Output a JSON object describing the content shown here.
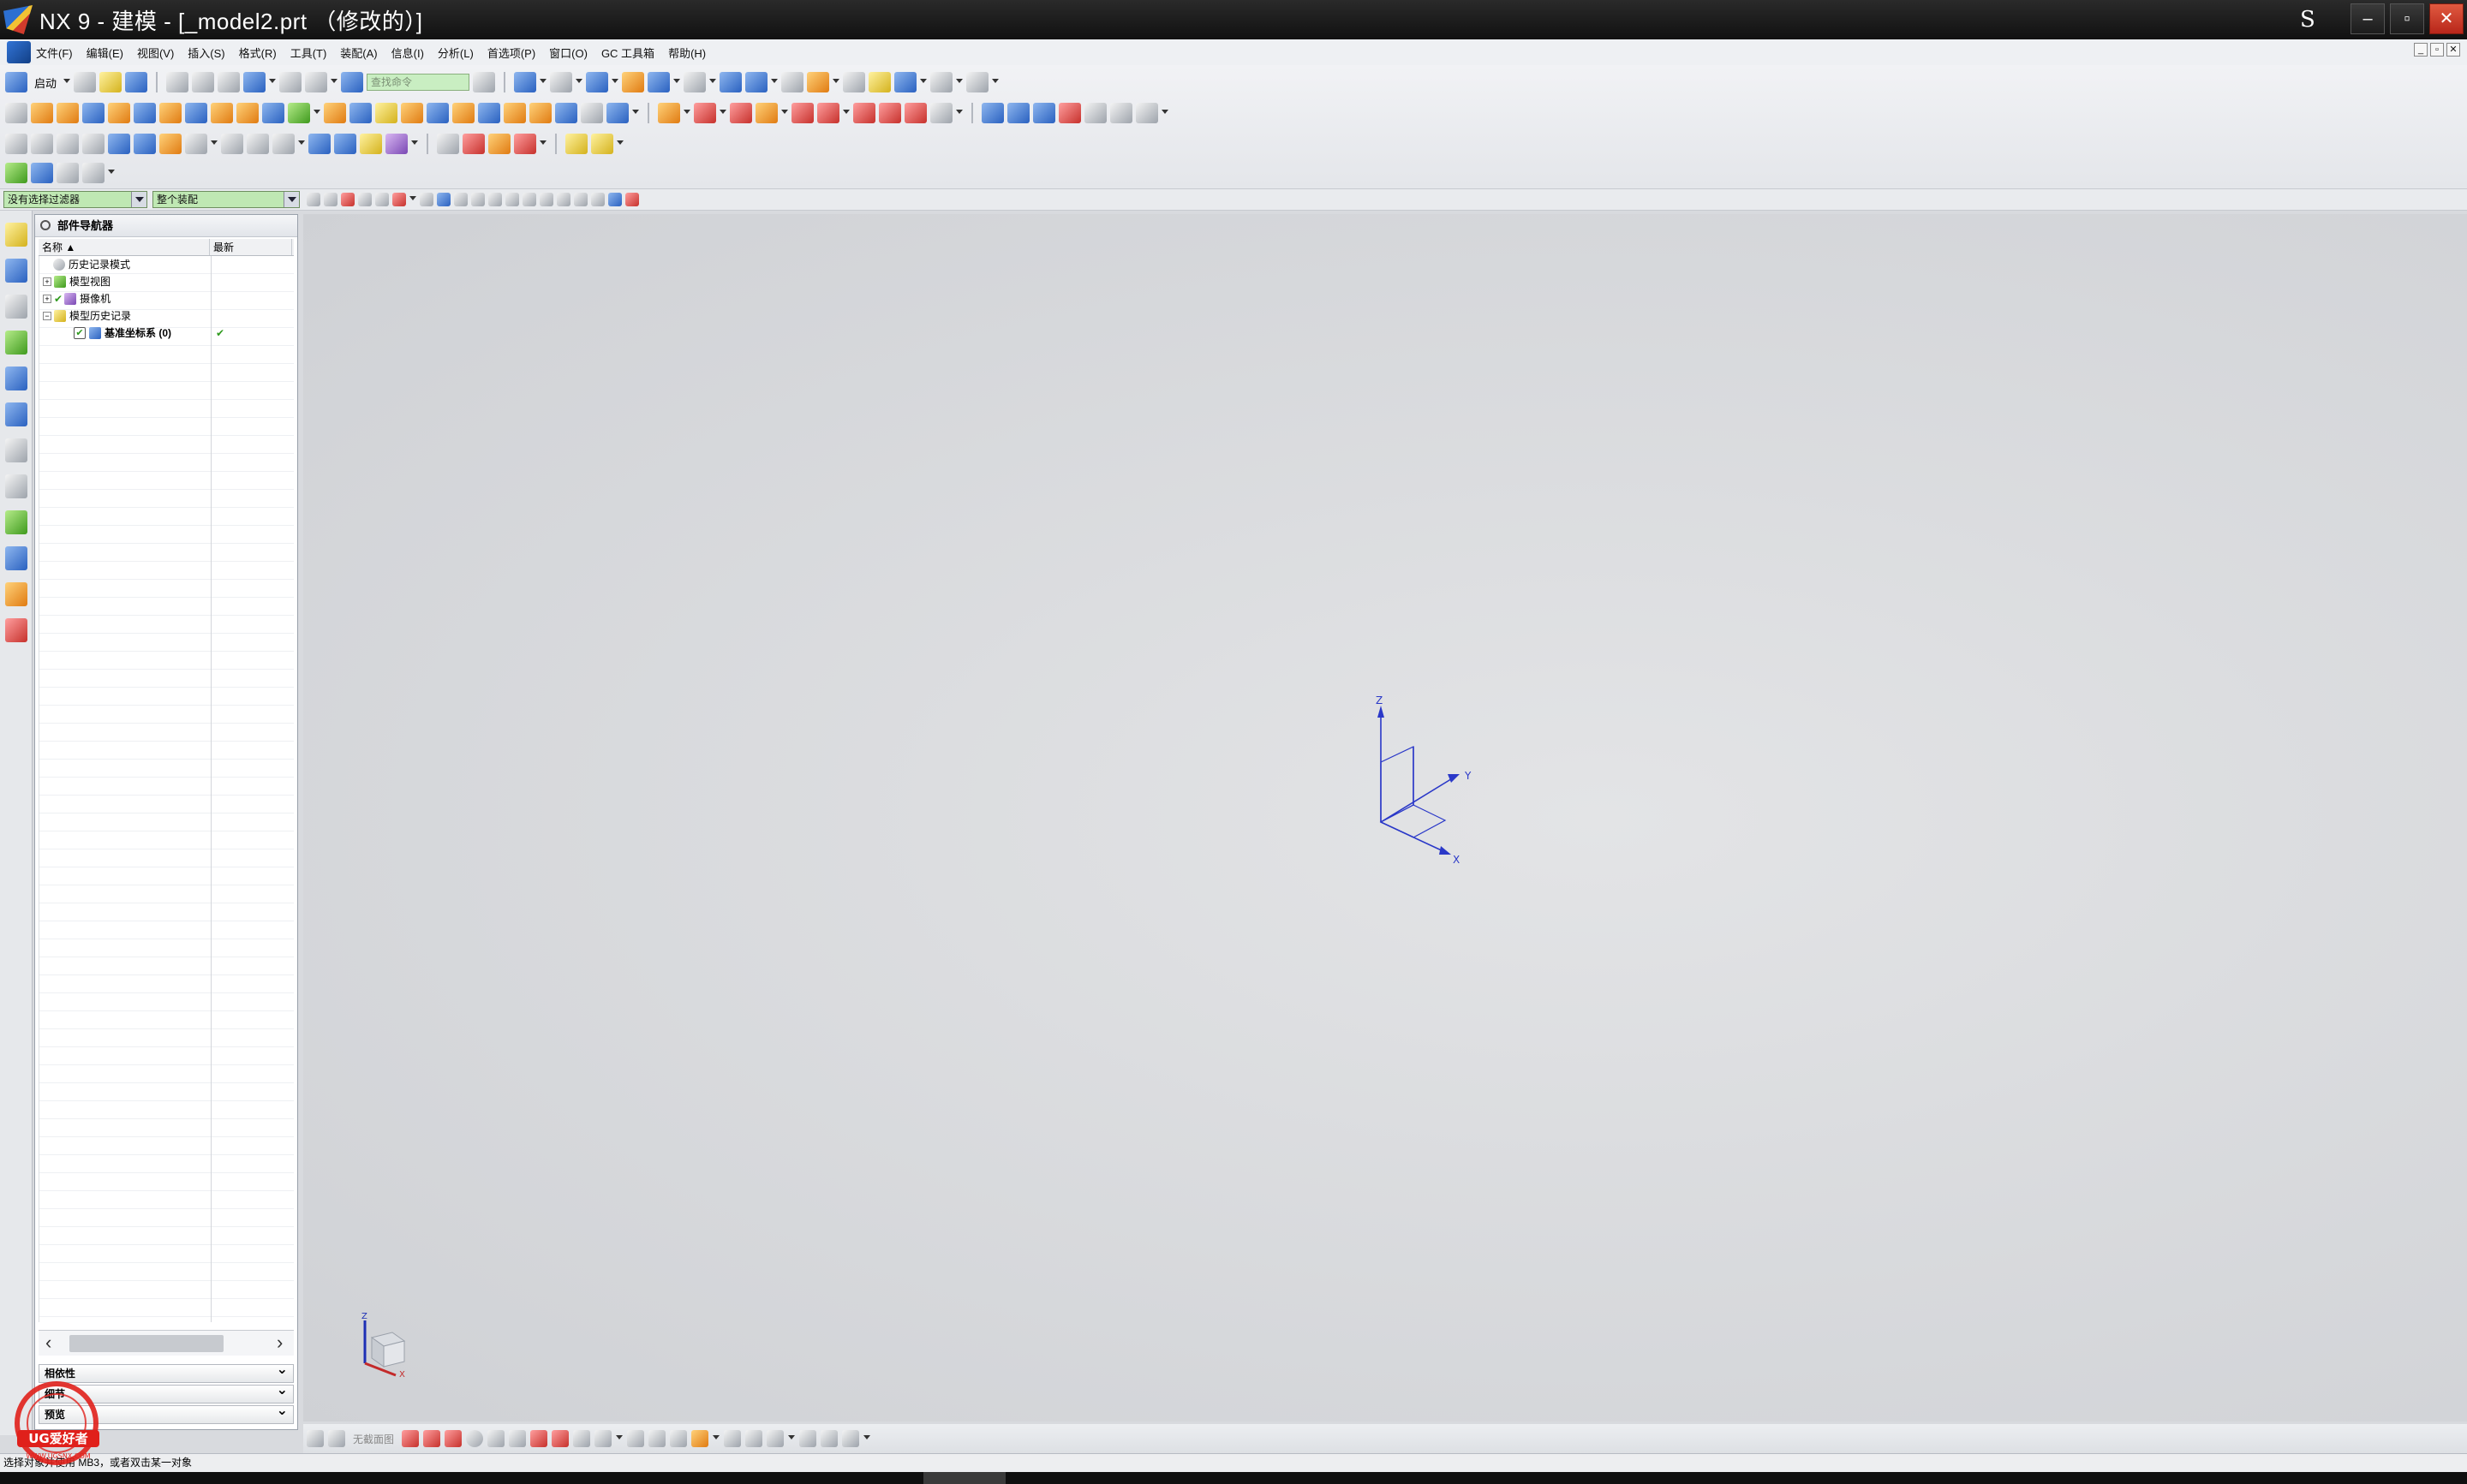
{
  "window": {
    "title": "NX 9 - 建模 - [_model2.prt （修改的）]",
    "right_label": "S",
    "minimize": "–",
    "restore": "▫",
    "close": "✕"
  },
  "menu": {
    "items": [
      "文件(F)",
      "编辑(E)",
      "视图(V)",
      "插入(S)",
      "格式(R)",
      "工具(T)",
      "装配(A)",
      "信息(I)",
      "分析(L)",
      "首选项(P)",
      "窗口(O)",
      "GC 工具箱",
      "帮助(H)"
    ]
  },
  "toolbar": {
    "start_label": "启动",
    "command_search": "查找命令"
  },
  "selection_bar": {
    "filter_value": "没有选择过滤器",
    "scope_value": "整个装配"
  },
  "navigator": {
    "title": "部件导航器",
    "columns": [
      "名称",
      "最新"
    ],
    "rows": [
      {
        "label": "历史记录模式",
        "expander": "",
        "latest": ""
      },
      {
        "label": "模型视图",
        "expander": "+",
        "latest": ""
      },
      {
        "label": "摄像机",
        "expander": "+",
        "latest": ""
      },
      {
        "label": "模型历史记录",
        "expander": "−",
        "latest": ""
      },
      {
        "label": "基准坐标系 (0)",
        "expander": "",
        "latest": "✔"
      }
    ],
    "sections": [
      "相依性",
      "细节",
      "预览"
    ],
    "scroll_left": "‹",
    "scroll_right": "›"
  },
  "graphics": {
    "axis_x": "X",
    "axis_y": "Y",
    "axis_z": "Z",
    "mini_x": "X",
    "mini_z": "Z",
    "triad_color": "#2a38c8"
  },
  "bottom_toolbar": {
    "mode_label": "无截面图"
  },
  "status": {
    "message": "选择对象并使用 MB3，或者双击某一对象"
  },
  "watermark": {
    "text": "UG爱好者",
    "url": "WWW.UGSNX.COM"
  },
  "colors": {
    "selection_combo": "#bfe8b3",
    "check_green": "#2f9a1e"
  }
}
